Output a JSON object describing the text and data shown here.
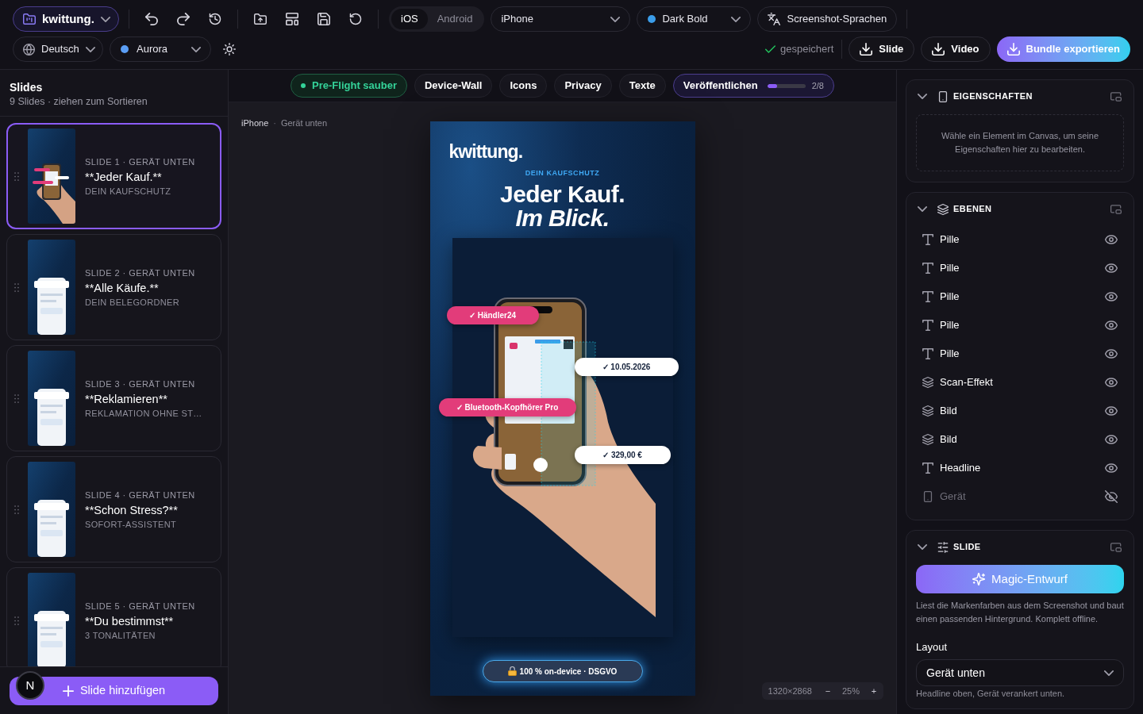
{
  "header": {
    "project": {
      "label": "kwittung."
    },
    "platforms": [
      {
        "label": "iOS",
        "selected": true
      },
      {
        "label": "Android",
        "selected": false
      }
    ],
    "device": {
      "value": "iPhone"
    },
    "theme": {
      "value": "Dark Bold",
      "color": "#3b9de9"
    },
    "languages_button": {
      "label": "Screenshot-Sprachen"
    },
    "language": {
      "value": "Deutsch"
    },
    "palette": {
      "value": "Aurora",
      "color": "#5b9ef5"
    },
    "save_status": "gespeichert",
    "exports": [
      {
        "label": "Slide",
        "kind": "outline"
      },
      {
        "label": "Video",
        "kind": "outline"
      },
      {
        "label": "Bundle exportieren",
        "kind": "primary"
      }
    ]
  },
  "sidebar": {
    "title": "Slides",
    "subtitle": "9 Slides · ziehen zum Sortieren",
    "slides": [
      {
        "meta": "SLIDE 1 · GERÄT UNTEN",
        "title": "**Jeder Kauf.**",
        "caption": "DEIN KAUFSCHUTZ",
        "selected": true
      },
      {
        "meta": "SLIDE 2 · GERÄT UNTEN",
        "title": "**Alle Käufe.**",
        "caption": "DEIN BELEGORDNER",
        "selected": false
      },
      {
        "meta": "SLIDE 3 · GERÄT UNTEN",
        "title": "**Reklamieren**",
        "caption": "REKLAMATION OHNE ST…",
        "selected": false
      },
      {
        "meta": "SLIDE 4 · GERÄT UNTEN",
        "title": "**Schon Stress?**",
        "caption": "SOFORT-ASSISTENT",
        "selected": false
      },
      {
        "meta": "SLIDE 5 · GERÄT UNTEN",
        "title": "**Du bestimmst**",
        "caption": "3 TONALITÄTEN",
        "selected": false
      }
    ],
    "add_button": "Slide hinzufügen",
    "dev_badge": "N"
  },
  "checks": [
    {
      "label": "Pre-Flight sauber",
      "kind": "status"
    },
    {
      "label": "Device-Wall",
      "kind": "plain"
    },
    {
      "label": "Icons",
      "kind": "plain"
    },
    {
      "label": "Privacy",
      "kind": "plain"
    },
    {
      "label": "Texte",
      "kind": "plain"
    },
    {
      "label": "Veröffentlichen",
      "kind": "progress",
      "level": 0.25,
      "count": "2/8"
    }
  ],
  "canvas": {
    "breadcrumb": {
      "device": "iPhone",
      "separator": "·",
      "layout": "Gerät unten"
    },
    "slide": {
      "logo": "kwittung.",
      "eyebrow": "DEIN KAUFSCHUTZ",
      "headline": [
        {
          "text": "Jeder Kauf.",
          "italic": false
        },
        {
          "text": "Im Blick.",
          "italic": true
        }
      ],
      "pills": [
        {
          "label": "✓ Händler24",
          "kind": "accent"
        },
        {
          "label": "✓ 10.05.2026",
          "kind": "light"
        },
        {
          "label": "✓ Bluetooth-Kopfhörer Pro",
          "kind": "accent"
        },
        {
          "label": "✓ 329,00 €",
          "kind": "light"
        }
      ],
      "badge": "100 % on-device · DSGVO"
    },
    "zoom": {
      "size": "1320×2868",
      "decrease": "−",
      "value": "25%",
      "increase": "+"
    }
  },
  "inspector": {
    "properties": {
      "title": "EIGENSCHAFTEN",
      "expanded": true,
      "hint": "Wähle ein Element im Canvas, um seine Eigenschaften hier zu bearbeiten."
    },
    "layers": {
      "title": "EBENEN",
      "expanded": true,
      "items": [
        {
          "name": "Pille",
          "kind": "text",
          "visible": true
        },
        {
          "name": "Pille",
          "kind": "text",
          "visible": true
        },
        {
          "name": "Pille",
          "kind": "text",
          "visible": true
        },
        {
          "name": "Pille",
          "kind": "text",
          "visible": true
        },
        {
          "name": "Pille",
          "kind": "text",
          "visible": true
        },
        {
          "name": "Scan-Effekt",
          "kind": "group",
          "visible": true
        },
        {
          "name": "Bild",
          "kind": "group",
          "visible": true
        },
        {
          "name": "Bild",
          "kind": "group",
          "visible": true
        },
        {
          "name": "Headline",
          "kind": "text",
          "visible": true
        },
        {
          "name": "Gerät",
          "kind": "device",
          "visible": false
        }
      ]
    },
    "slide": {
      "title": "SLIDE",
      "expanded": true,
      "magic_button": "Magic-Entwurf",
      "magic_hint": "Liest die Markenfarben aus dem Screenshot und baut einen passenden Hintergrund. Komplett offline.",
      "layout_label": "Layout",
      "layout_value": "Gerät unten",
      "layout_hint": "Headline oben, Gerät verankert unten."
    }
  }
}
